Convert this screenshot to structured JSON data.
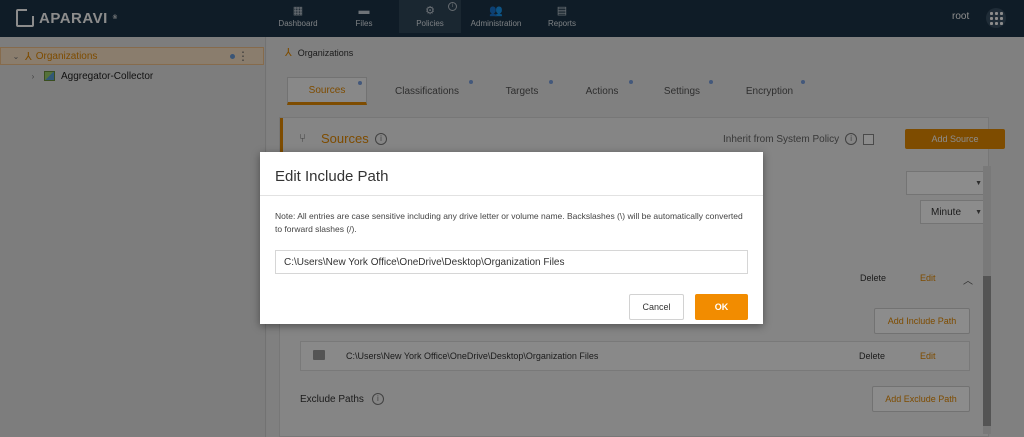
{
  "app": {
    "brand": "APARAVI",
    "user": "root"
  },
  "nav": [
    {
      "label": "Dashboard",
      "icon": "dashboard-icon",
      "active": false
    },
    {
      "label": "Files",
      "icon": "folder-icon",
      "active": false
    },
    {
      "label": "Policies",
      "icon": "gear-icon",
      "active": true
    },
    {
      "label": "Administration",
      "icon": "users-icon",
      "active": false
    },
    {
      "label": "Reports",
      "icon": "report-icon",
      "active": false
    }
  ],
  "sidebar": {
    "items": [
      {
        "label": "Organizations",
        "icon": "organization-icon",
        "selected": true
      },
      {
        "label": "Aggregator-Collector",
        "icon": "aggregator-icon",
        "selected": false
      }
    ]
  },
  "breadcrumb": {
    "label": "Organizations"
  },
  "tabs": [
    {
      "label": "Sources",
      "active": true
    },
    {
      "label": "Classifications",
      "active": false
    },
    {
      "label": "Targets",
      "active": false
    },
    {
      "label": "Actions",
      "active": false
    },
    {
      "label": "Settings",
      "active": false
    },
    {
      "label": "Encryption",
      "active": false
    }
  ],
  "sources": {
    "title": "Sources",
    "inherit_label": "Inherit from System Policy",
    "add_source": "Add Source",
    "frequency_unit": "Minute",
    "row_delete": "Delete",
    "row_edit": "Edit",
    "add_include": "Add Include Path",
    "include_path": "C:\\Users\\New York Office\\OneDrive\\Desktop\\Organization Files",
    "path_delete": "Delete",
    "path_edit": "Edit",
    "exclude_label": "Exclude Paths",
    "add_exclude": "Add Exclude Path"
  },
  "modal": {
    "title": "Edit Include Path",
    "note": "Note: All entries are case sensitive including any drive letter or volume name. Backslashes (\\) will be automatically converted to forward slashes (/).",
    "path_value": "C:\\Users\\New York Office\\OneDrive\\Desktop\\Organization Files",
    "cancel": "Cancel",
    "ok": "OK"
  },
  "colors": {
    "accent": "#e58a00",
    "topbar": "#1d3447"
  }
}
